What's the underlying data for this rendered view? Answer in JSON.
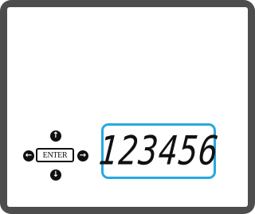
{
  "controls": {
    "enter_label": "ENTER",
    "arrow_up": "↑",
    "arrow_down": "↓",
    "arrow_left": "←",
    "arrow_right": "→"
  },
  "display": {
    "value": "123456"
  },
  "colors": {
    "frame": "#4d4d4d",
    "display_border": "#27a8e0"
  }
}
